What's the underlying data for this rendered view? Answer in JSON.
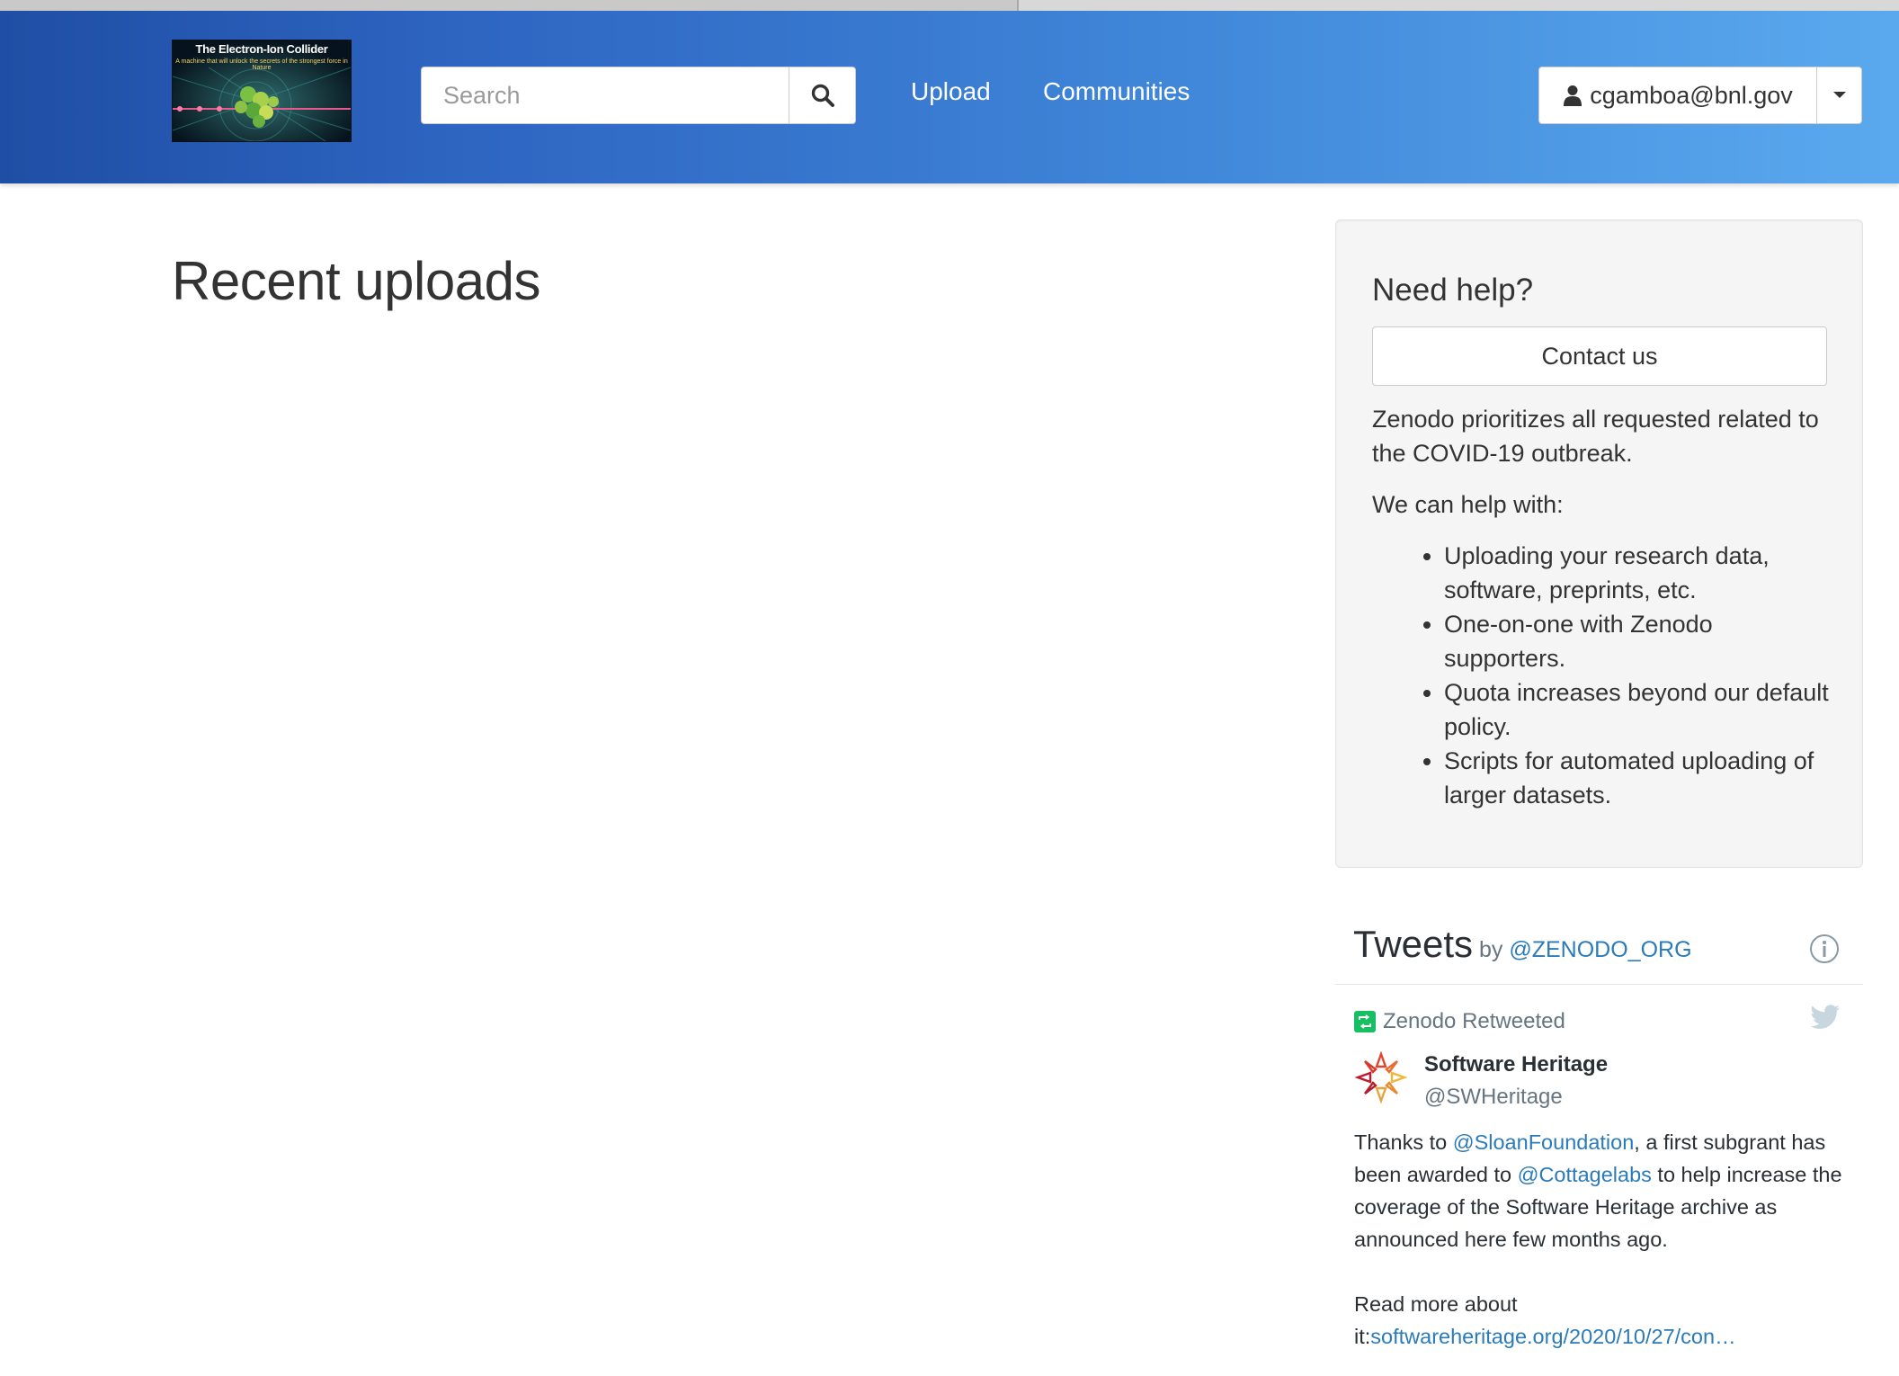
{
  "header": {
    "logo": {
      "title": "The Electron-Ion Collider",
      "subtitle": "A machine that will unlock the secrets of the strongest force in Nature"
    },
    "search": {
      "placeholder": "Search",
      "value": "",
      "button_icon": "search-icon"
    },
    "nav": [
      {
        "label": "Upload"
      },
      {
        "label": "Communities"
      }
    ],
    "user": {
      "icon": "user-icon",
      "email": "cgamboa@bnl.gov",
      "caret_icon": "caret-down-icon"
    }
  },
  "main": {
    "title": "Recent uploads"
  },
  "help": {
    "title": "Need help?",
    "contact_label": "Contact us",
    "paragraph1": "Zenodo prioritizes all requested related to the COVID-19 outbreak.",
    "paragraph2": "We can help with:",
    "items": [
      "Uploading your research data, software, preprints, etc.",
      "One-on-one with Zenodo supporters.",
      "Quota increases beyond our default policy.",
      "Scripts for automated uploading of larger datasets."
    ]
  },
  "tweets": {
    "title": "Tweets",
    "by": "by",
    "handle": "@ZENODO_ORG",
    "retweeted_label": "Zenodo Retweeted",
    "tweet": {
      "author_name": "Software Heritage",
      "author_handle": "@SWHeritage",
      "text_parts": {
        "p1": "Thanks to ",
        "link1": "@SloanFoundation",
        "p2": ",  a first subgrant has been awarded to ",
        "link2": "@Cottagelabs",
        "p3": " to help increase the coverage of the Software Heritage archive as announced here few months ago.",
        "p4": "Read more about it:",
        "link3": "softwareheritage.org/2020/10/27/con…"
      }
    }
  },
  "colors": {
    "navbar_start": "#1f4ea5",
    "navbar_end": "#5aa9ee",
    "link": "#2b7bb9",
    "retweet_green": "#17bf63"
  }
}
